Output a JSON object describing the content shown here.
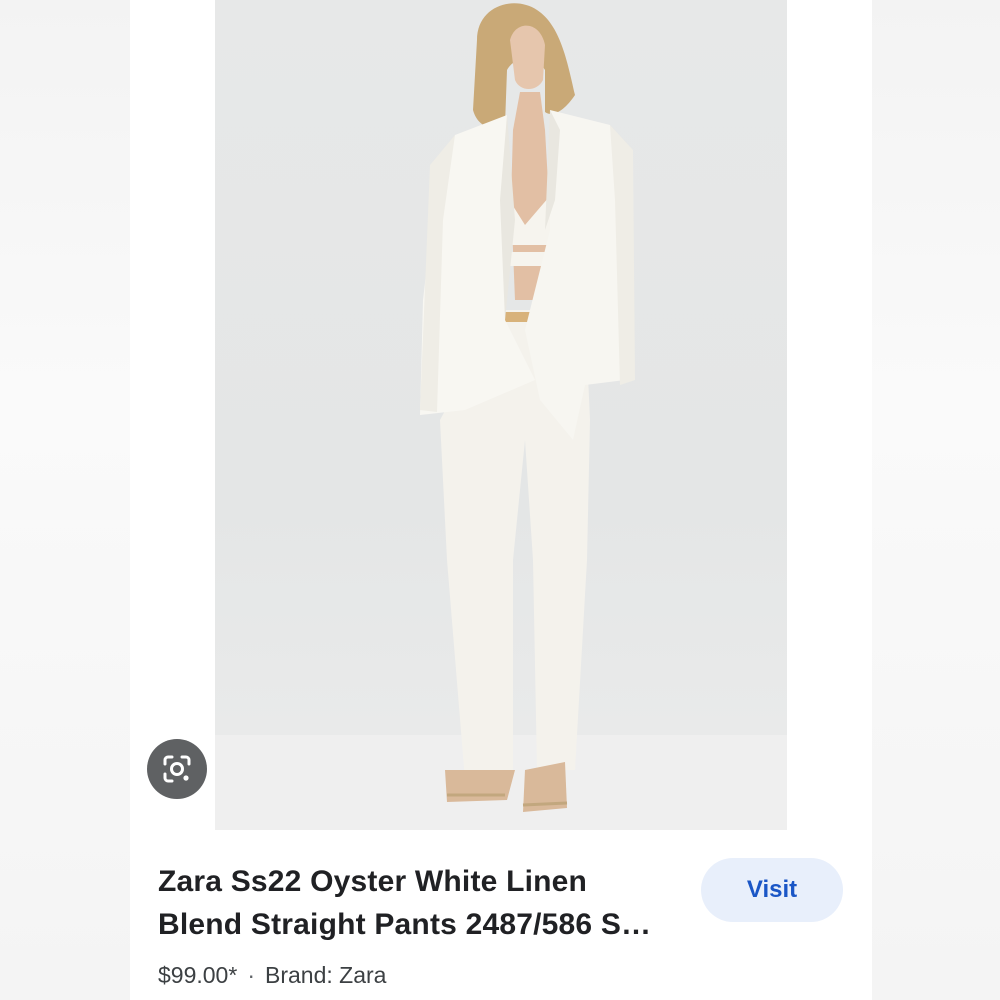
{
  "product": {
    "title": "Zara Ss22 Oyster White Linen Blend Straight Pants 2487/586 S…",
    "price": "$99.00*",
    "separator": "·",
    "brand": "Brand: Zara"
  },
  "actions": {
    "visit_label": "Visit"
  },
  "icons": {
    "lens": "google-lens-camera-icon"
  },
  "colors": {
    "visit_bg": "#e8effb",
    "visit_text": "#1a56c6",
    "lens_bg": "#5f6163",
    "title_text": "#202124"
  }
}
